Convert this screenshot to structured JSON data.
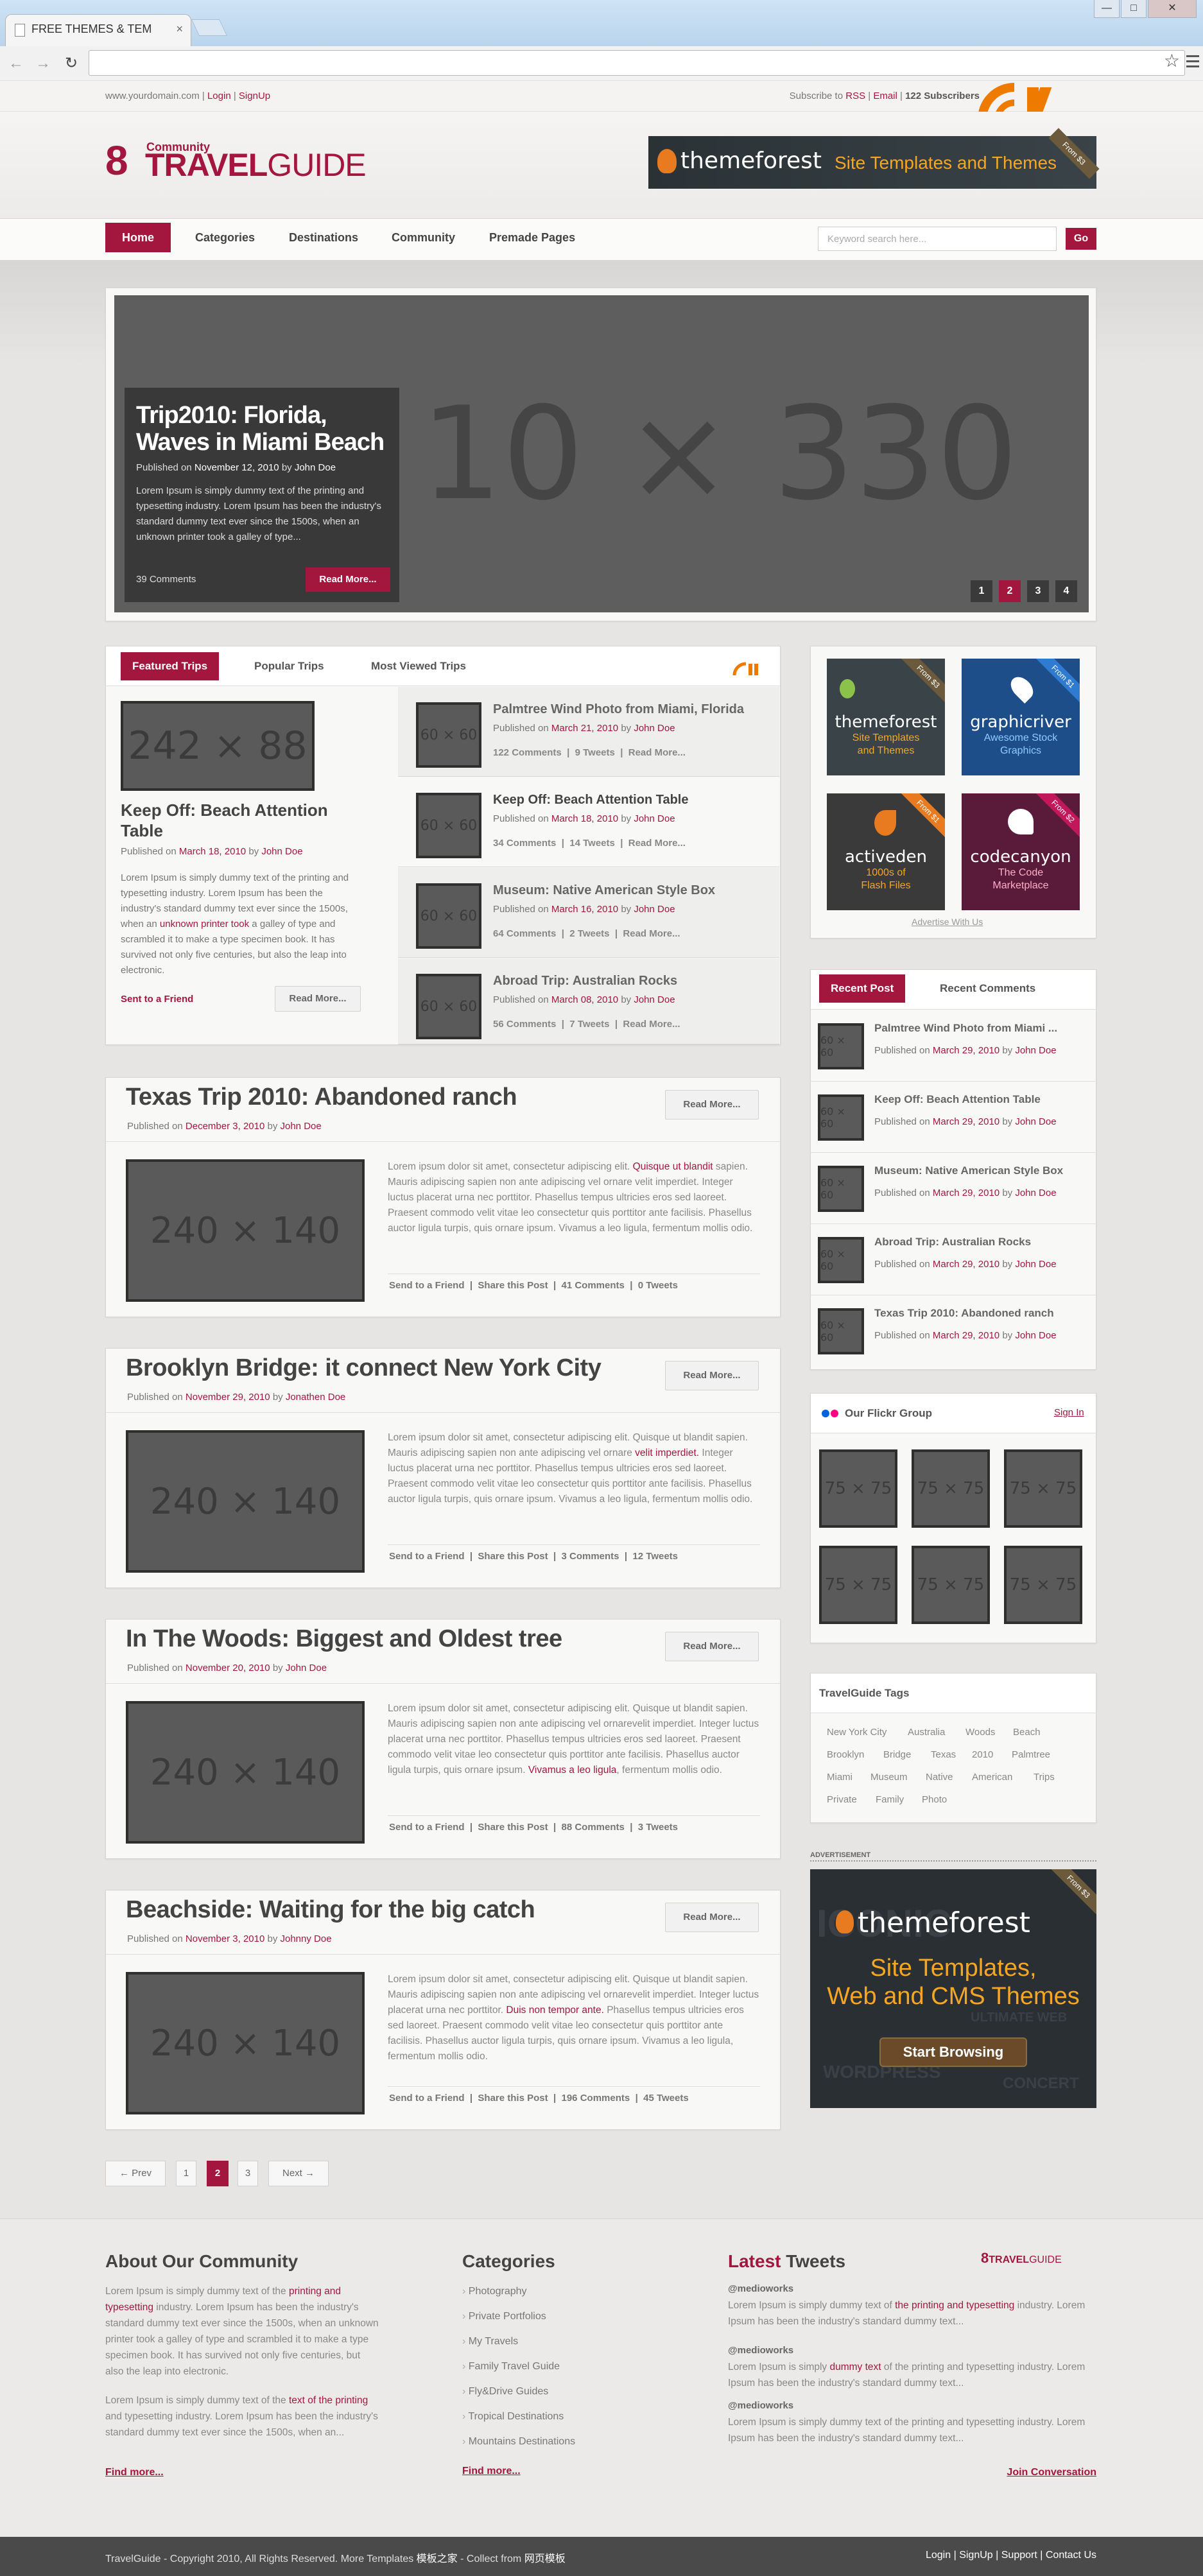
{
  "browser": {
    "tab_title": "FREE THEMES & TEM",
    "tab_close": "×",
    "back": "←",
    "forward": "→",
    "reload": "↻",
    "star": "☆",
    "win_min": "—",
    "win_max": "□",
    "win_close": "✕"
  },
  "topbar": {
    "domain": "www.yourdomain.com",
    "sep1": "|",
    "login": "Login",
    "sep2": "|",
    "signup": "SignUp",
    "subscribe_to": "Subscribe to",
    "rss": "RSS",
    "sep3": "|",
    "email": "Email",
    "sep4": "|",
    "subscribers": "122 Subscribers"
  },
  "logo": {
    "number": "8",
    "community": "Community",
    "travel": "TRAVEL",
    "guide": "GUIDE"
  },
  "banner": {
    "brand": "themeforest",
    "tagline": "Site Templates and Themes",
    "price": "From $3"
  },
  "nav": {
    "items": [
      "Home",
      "Categories",
      "Destinations",
      "Community",
      "Premade Pages"
    ],
    "search_placeholder": "Keyword search here...",
    "go": "Go"
  },
  "slider": {
    "placeholder": "10 × 330",
    "title": "Trip2010: Florida, Waves in Miami Beach",
    "published_on": "Published on",
    "date": "November 12, 2010",
    "by": "by",
    "author": "John Doe",
    "excerpt": "Lorem Ipsum is simply dummy text of the printing and typesetting industry. Lorem Ipsum has been the industry's standard dummy text ever since the 1500s, when an unknown printer took a galley of type...",
    "comments": "39 Comments",
    "read_more": "Read More...",
    "pages": [
      "1",
      "2",
      "3",
      "4"
    ],
    "active_page": "2"
  },
  "featured": {
    "tabs": [
      "Featured Trips",
      "Popular Trips",
      "Most Viewed Trips"
    ],
    "main": {
      "placeholder": "242 × 88",
      "title": "Keep Off: Beach Attention Table",
      "published_on": "Published on",
      "date": "March 18, 2010",
      "by": "by",
      "author": "John Doe",
      "excerpt_a": "Lorem Ipsum is simply dummy text of the printing and typesetting industry. Lorem Ipsum has been the industry's standard dummy text ever since the 1500s, when an ",
      "excerpt_link": "unknown printer took",
      "excerpt_b": " a galley of type and scrambled it to make a type specimen book. It has survived not only five centuries, but also the leap into electronic.",
      "send": "Sent to a Friend",
      "read_more": "Read More..."
    },
    "list": [
      {
        "thumb": "60 × 60",
        "title": "Palmtree Wind Photo from Miami, Florida",
        "published_on": "Published on",
        "date": "March 21, 2010",
        "by": "by",
        "author": "John Doe",
        "comments": "122 Comments",
        "tweets": "9 Tweets",
        "more": "Read More...",
        "sep": "|"
      },
      {
        "thumb": "60 × 60",
        "title": "Keep Off: Beach Attention Table",
        "published_on": "Published on",
        "date": "March 18, 2010",
        "by": "by",
        "author": "John Doe",
        "comments": "34 Comments",
        "tweets": "14 Tweets",
        "more": "Read More...",
        "sep": "|"
      },
      {
        "thumb": "60 × 60",
        "title": "Museum: Native American Style Box",
        "published_on": "Published on",
        "date": "March 16, 2010",
        "by": "by",
        "author": "John Doe",
        "comments": "64 Comments",
        "tweets": "2 Tweets",
        "more": "Read More...",
        "sep": "|"
      },
      {
        "thumb": "60 × 60",
        "title": "Abroad Trip: Australian Rocks",
        "published_on": "Published on",
        "date": "March 08, 2010",
        "by": "by",
        "author": "John Doe",
        "comments": "56 Comments",
        "tweets": "7 Tweets",
        "more": "Read More...",
        "sep": "|"
      }
    ]
  },
  "articles": [
    {
      "title": "Texas Trip 2010: Abandoned ranch",
      "published_on": "Published on",
      "date": "December 3, 2010",
      "by": "by",
      "author": "John Doe",
      "read_more": "Read More...",
      "placeholder": "240 × 140",
      "body_a": "Lorem ipsum dolor sit amet, consectetur adipiscing elit. ",
      "link": "Quisque ut blandit",
      "body_b": " sapien. Mauris adipiscing sapien non ante adipiscing vel ornare velit imperdiet. Integer luctus placerat urna nec porttitor. Phasellus tempus ultricies eros sed laoreet. Praesent commodo velit vitae leo consectetur quis porttitor ante facilisis. Phasellus auctor ligula turpis, quis ornare ipsum. Vivamus a leo ligula, fermentum mollis odio.",
      "send": "Send to a Friend",
      "share": "Share this Post",
      "comments": "41 Comments",
      "tweets": "0 Tweets",
      "sep": "|"
    },
    {
      "title": "Brooklyn Bridge: it connect New York City",
      "published_on": "Published on",
      "date": "November 29, 2010",
      "by": "by",
      "author": "Jonathen Doe",
      "read_more": "Read More...",
      "placeholder": "240 × 140",
      "body_a": "Lorem ipsum dolor sit amet, consectetur adipiscing elit. Quisque ut blandit sapien. Mauris adipiscing sapien non ante adipiscing vel ornare ",
      "link": "velit imperdiet.",
      "body_b": " Integer luctus placerat urna nec porttitor. Phasellus tempus ultricies eros sed laoreet. Praesent commodo velit vitae leo consectetur quis porttitor ante facilisis. Phasellus auctor ligula turpis, quis ornare ipsum. Vivamus a leo ligula, fermentum mollis odio.",
      "send": "Send to a Friend",
      "share": "Share this Post",
      "comments": "3 Comments",
      "tweets": "12 Tweets",
      "sep": "|"
    },
    {
      "title": "In The Woods: Biggest and Oldest tree",
      "published_on": "Published on",
      "date": "November 20, 2010",
      "by": "by",
      "author": "John Doe",
      "read_more": "Read More...",
      "placeholder": "240 × 140",
      "body_a": "Lorem ipsum dolor sit amet, consectetur adipiscing elit. Quisque ut blandit sapien. Mauris adipiscing sapien non ante adipiscing vel ornarevelit imperdiet. Integer luctus placerat urna nec porttitor. Phasellus tempus ultricies eros sed laoreet. Praesent commodo velit vitae leo consectetur quis porttitor ante facilisis. Phasellus auctor ligula turpis, quis ornare ipsum. ",
      "link": "Vivamus a leo ligula",
      "body_b": ", fermentum mollis odio.",
      "send": "Send to a Friend",
      "share": "Share this Post",
      "comments": "88 Comments",
      "tweets": "3 Tweets",
      "sep": "|"
    },
    {
      "title": "Beachside: Waiting for the big catch",
      "published_on": "Published on",
      "date": "November 3, 2010",
      "by": "by",
      "author": "Johnny Doe",
      "read_more": "Read More...",
      "placeholder": "240 × 140",
      "body_a": "Lorem ipsum dolor sit amet, consectetur adipiscing elit. Quisque ut blandit sapien. Mauris adipiscing sapien non ante adipiscing vel ornarevelit imperdiet. Integer luctus placerat urna nec porttitor. ",
      "link": "Duis non tempor ante.",
      "body_b": " Phasellus tempus ultricies eros sed laoreet. Praesent commodo velit vitae leo consectetur quis porttitor ante facilisis. Phasellus auctor ligula turpis, quis ornare ipsum. Vivamus a leo ligula, fermentum mollis odio.",
      "send": "Send to a Friend",
      "share": "Share this Post",
      "comments": "196 Comments",
      "tweets": "45 Tweets",
      "sep": "|"
    }
  ],
  "pagination": {
    "prev": "← Prev",
    "pages": [
      "1",
      "2",
      "3"
    ],
    "active": "2",
    "next": "Next →"
  },
  "ads": {
    "items": [
      {
        "brand": "themeforest",
        "sub": "Site Templates and Themes",
        "price": "From $3",
        "color": "#3a4347"
      },
      {
        "brand": "graphicriver",
        "sub": "Awesome Stock Graphics",
        "price": "From $1",
        "color": "#1d4e8a"
      },
      {
        "brand": "activeden",
        "sub": "1000s of Flash Files",
        "price": "From $1",
        "color": "#3a3a3a"
      },
      {
        "brand": "codecanyon",
        "sub": "The Code Marketplace",
        "price": "From $2",
        "color": "#5a1a3a"
      }
    ],
    "advertise": "Advertise With Us"
  },
  "recent": {
    "tabs": [
      "Recent Post",
      "Recent Comments"
    ],
    "items": [
      {
        "thumb": "60 × 60",
        "title": "Palmtree Wind Photo from Miami ...",
        "published_on": "Published on",
        "date": "March 29, 2010",
        "by": "by",
        "author": "John Doe"
      },
      {
        "thumb": "60 × 60",
        "title": "Keep Off: Beach Attention Table",
        "published_on": "Published on",
        "date": "March 29, 2010",
        "by": "by",
        "author": "John Doe"
      },
      {
        "thumb": "60 × 60",
        "title": "Museum: Native American Style Box",
        "published_on": "Published on",
        "date": "March 29, 2010",
        "by": "by",
        "author": "John Doe"
      },
      {
        "thumb": "60 × 60",
        "title": "Abroad Trip: Australian Rocks",
        "published_on": "Published on",
        "date": "March 29, 2010",
        "by": "by",
        "author": "John Doe"
      },
      {
        "thumb": "60 × 60",
        "title": "Texas Trip 2010: Abandoned ranch",
        "published_on": "Published on",
        "date": "March 29, 2010",
        "by": "by",
        "author": "John Doe"
      }
    ]
  },
  "flickr": {
    "title": "Our Flickr Group",
    "signin": "Sign In",
    "thumb": "75 × 75"
  },
  "tags": {
    "title": "TravelGuide Tags",
    "items": [
      "New York City",
      "Australia",
      "Woods",
      "Beach",
      "Brooklyn",
      "Bridge",
      "Texas",
      "2010",
      "Palmtree",
      "Miami",
      "Museum",
      "Native",
      "American",
      "Trips",
      "Private",
      "Family",
      "Photo"
    ]
  },
  "advert": {
    "label": "ADVERTISEMENT",
    "brand": "themeforest",
    "line1": "Site Templates,",
    "line2": "Web and CMS Themes",
    "cta": "Start Browsing",
    "price": "From $3",
    "bg_words": [
      "ICONIC",
      "ULTIMATE WEB",
      "WORDPRESS",
      "CONCERT"
    ]
  },
  "footer": {
    "about_title": "About Our Community",
    "about_p1a": "Lorem Ipsum is simply dummy text of the ",
    "about_p1link": "printing and typesetting",
    "about_p1b": " industry. Lorem Ipsum has been the industry's standard dummy text ever since the 1500s, when an unknown printer took a galley of type and scrambled it to make a type specimen book. It has survived not only five centuries, but also the leap into electronic.",
    "about_p2a": "Lorem Ipsum is simply dummy text of the ",
    "about_p2link": "text of the printing",
    "about_p2b": " and typesetting industry. Lorem Ipsum has been the industry's standard dummy text ever since the 1500s, when an...",
    "find_more_1": "Find more...",
    "cat_title": "Categories",
    "categories": [
      "Photography",
      "Private Portfolios",
      "My Travels",
      "Family Travel Guide",
      "Fly&Drive Guides",
      "Tropical Destinations",
      "Mountains Destinations"
    ],
    "find_more_2": "Find more...",
    "tweets_latest": "Latest",
    "tweets_title": "Tweets",
    "tweets": [
      {
        "user": "@medioworks",
        "a": "Lorem Ipsum is simply dummy text of ",
        "link": "the printing and typesetting",
        "b": " industry. Lorem Ipsum has been the industry's standard dummy text..."
      },
      {
        "user": "@medioworks",
        "a": "Lorem Ipsum is simply ",
        "link": "dummy text",
        "b": " of the printing and typesetting industry. Lorem Ipsum has been the industry's standard dummy text..."
      },
      {
        "user": "@medioworks",
        "a": "Lorem Ipsum is simply dummy text of the printing and typesetting industry. Lorem Ipsum has been the industry's standard dummy text...",
        "link": "",
        "b": ""
      }
    ],
    "join": "Join Conversation"
  },
  "copyright": {
    "text": "TravelGuide - Copyright 2010, All Rights Reserved. More Templates",
    "link1": "模板之家",
    "mid": " - Collect from",
    "link2": "网页模板",
    "links": [
      "Login",
      "SignUp",
      "Support",
      "Contact Us"
    ],
    "sep": "|"
  },
  "colors": {
    "accent": "#a3173f",
    "dark": "#3a3a3a",
    "rss": "#ef7a00"
  }
}
